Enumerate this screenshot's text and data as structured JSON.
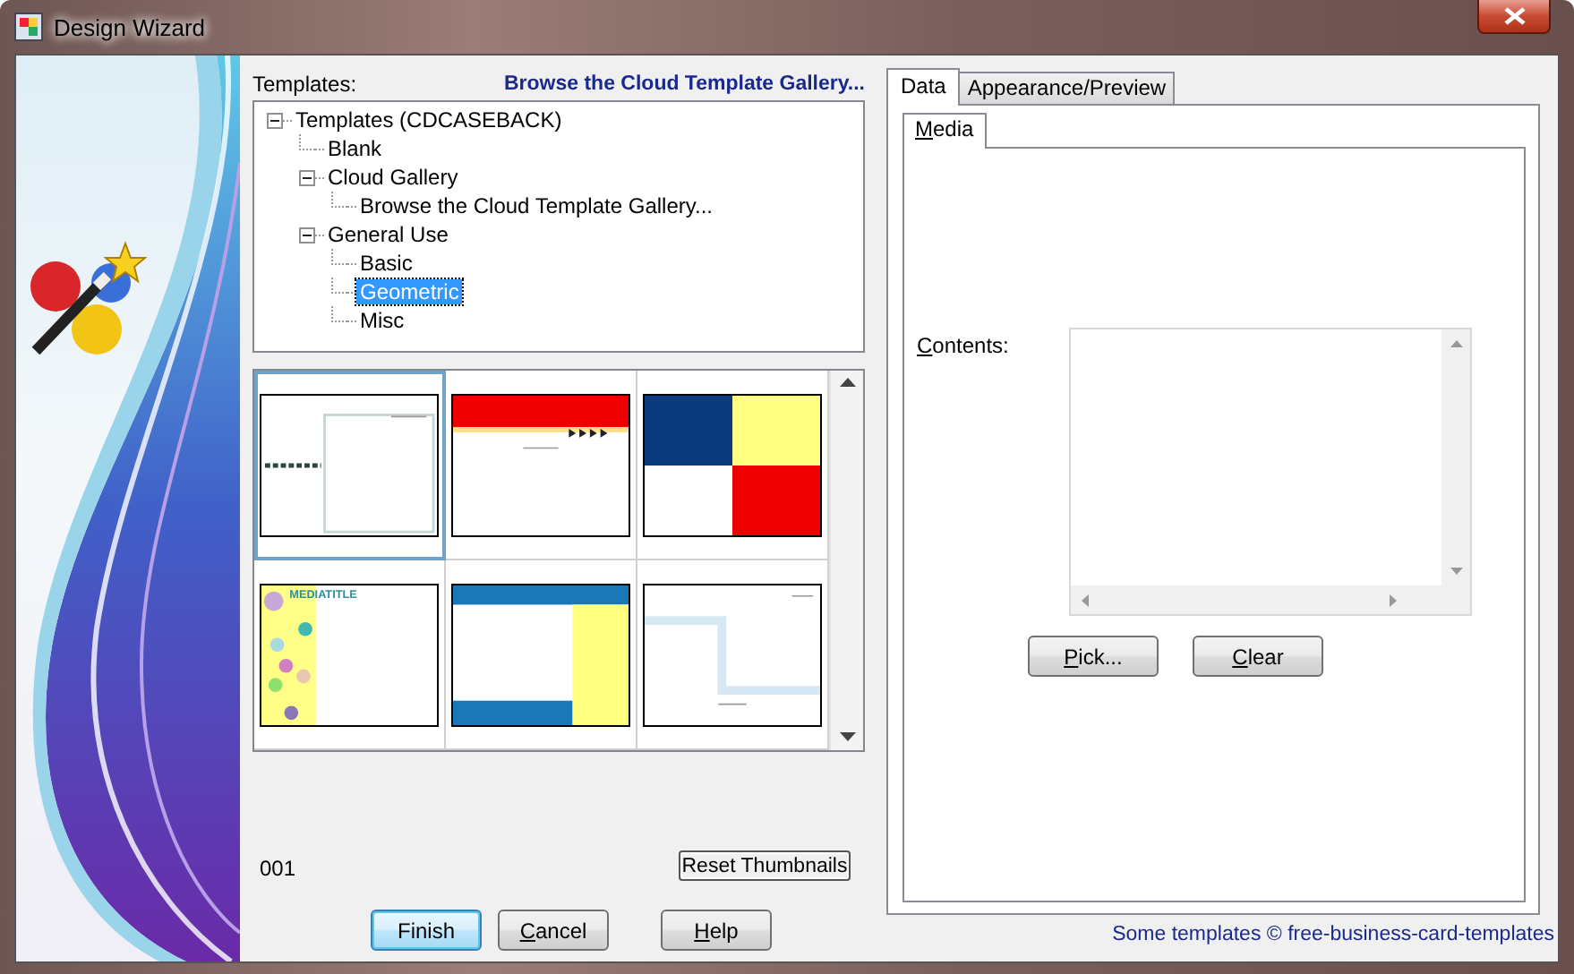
{
  "window": {
    "title": "Design Wizard"
  },
  "templates": {
    "label": "Templates:",
    "gallery_link": "Browse the Cloud Template Gallery...",
    "tree": [
      {
        "label": "Templates (CDCASEBACK)",
        "expanded": true,
        "selected": false,
        "children": [
          {
            "label": "Blank",
            "selected": false
          },
          {
            "label": "Cloud Gallery",
            "expanded": true,
            "selected": false,
            "children": [
              {
                "label": "Browse the Cloud Template Gallery...",
                "selected": false
              }
            ]
          },
          {
            "label": "General Use",
            "expanded": true,
            "selected": false,
            "children": [
              {
                "label": "Basic",
                "selected": false
              },
              {
                "label": "Geometric",
                "selected": true
              },
              {
                "label": "Misc",
                "selected": false
              }
            ]
          }
        ]
      }
    ]
  },
  "thumbnails": [
    {
      "kind": "frame",
      "selected": true
    },
    {
      "kind": "banner",
      "selected": false
    },
    {
      "kind": "quad",
      "selected": false
    },
    {
      "kind": "circles",
      "selected": false,
      "title": "MEDIATITLE"
    },
    {
      "kind": "columns",
      "selected": false
    },
    {
      "kind": "ribbon",
      "selected": false
    }
  ],
  "template_number": "001",
  "reset_button": "Reset Thumbnails",
  "buttons": [
    {
      "label": "Finish",
      "default": true,
      "first_letter_underlined": false
    },
    {
      "label": "Cancel",
      "first_letter_underlined": true,
      "default": false
    },
    {
      "label": "Help",
      "first_letter_underlined": true,
      "default": false
    }
  ],
  "tabs": [
    {
      "label": "Data",
      "selected": true
    },
    {
      "label": "Appearance/Preview",
      "selected": false
    }
  ],
  "subtabs": [
    {
      "label": "Media",
      "first_letter_underlined": true,
      "selected": true
    }
  ],
  "contents": {
    "label": "Contents:",
    "first_letter_underlined": true
  },
  "content_buttons": [
    {
      "label": "Pick...",
      "first_letter_underlined": true
    },
    {
      "label": "Clear",
      "first_letter_underlined": true
    }
  ],
  "credit": "Some templates © free-business-card-templates"
}
